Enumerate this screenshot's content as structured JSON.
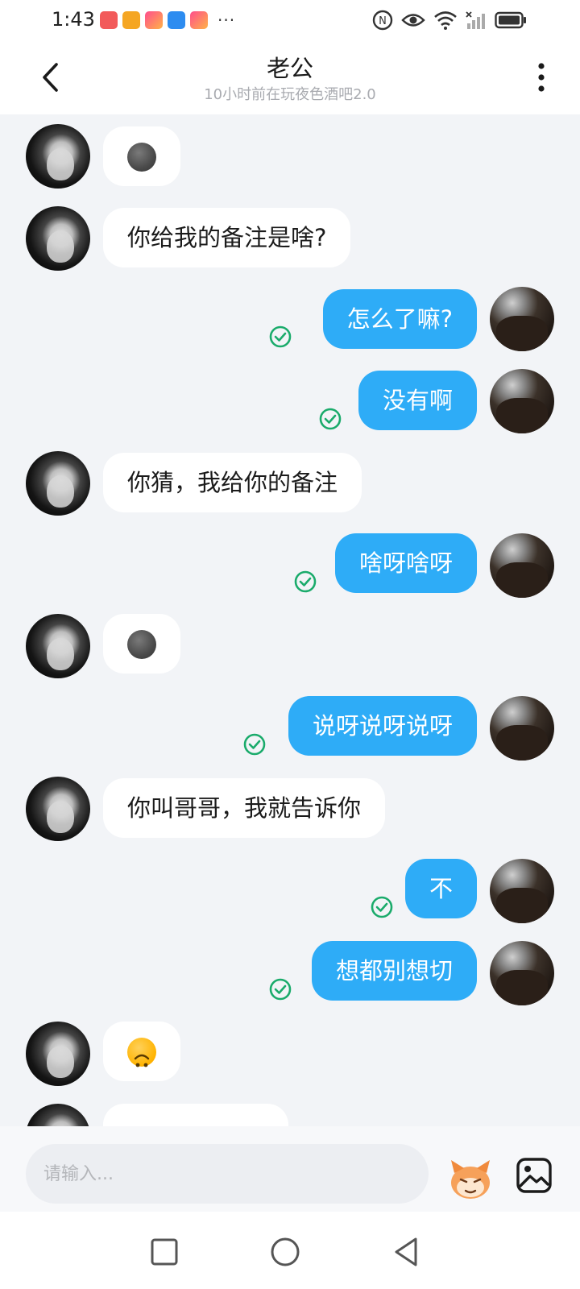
{
  "status_bar": {
    "time": "1:43",
    "more_indicator": "···"
  },
  "header": {
    "title": "老公",
    "subtitle": "10小时前在玩夜色酒吧2.0"
  },
  "messages": [
    {
      "side": "left",
      "type": "emoji",
      "emoji": "new-moon-face"
    },
    {
      "side": "left",
      "type": "text",
      "text": "你给我的备注是啥?"
    },
    {
      "side": "right",
      "type": "text",
      "text": "怎么了嘛?",
      "status": "read"
    },
    {
      "side": "right",
      "type": "text",
      "text": "没有啊",
      "status": "read"
    },
    {
      "side": "left",
      "type": "text",
      "text": "你猜，我给你的备注"
    },
    {
      "side": "right",
      "type": "text",
      "text": "啥呀啥呀",
      "status": "read"
    },
    {
      "side": "left",
      "type": "emoji",
      "emoji": "new-moon-face"
    },
    {
      "side": "right",
      "type": "text",
      "text": "说呀说呀说呀",
      "status": "read"
    },
    {
      "side": "left",
      "type": "text",
      "text": "你叫哥哥，我就告诉你"
    },
    {
      "side": "right",
      "type": "text",
      "text": "不",
      "status": "read"
    },
    {
      "side": "right",
      "type": "text",
      "text": "想都别想切",
      "status": "read"
    },
    {
      "side": "left",
      "type": "emoji",
      "emoji": "upside-down-face"
    }
  ],
  "input": {
    "placeholder": "请输入..."
  },
  "colors": {
    "outgoing_bubble": "#2eacf7",
    "incoming_bubble": "#ffffff",
    "read_check": "#1aab6b",
    "chat_background": "#f2f4f7"
  }
}
